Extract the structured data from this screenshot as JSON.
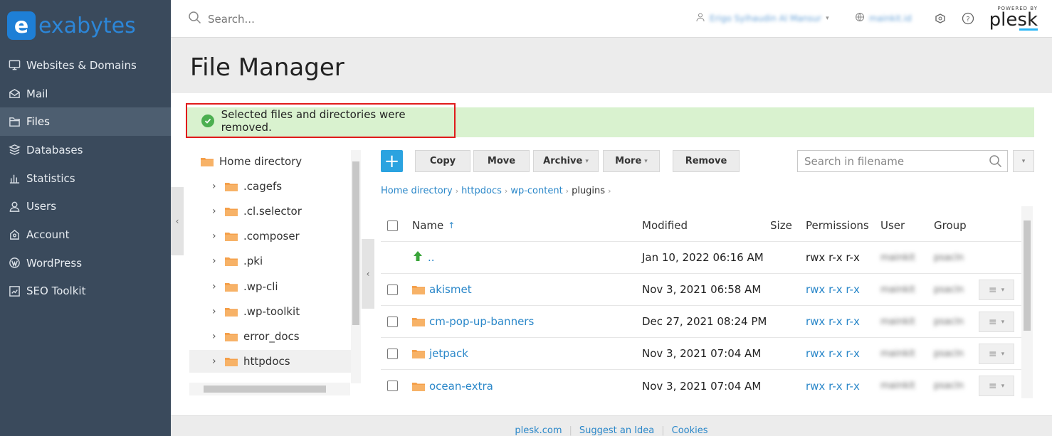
{
  "brand": {
    "logo_letter": "e",
    "logo_text": "exabytes"
  },
  "sidebar": {
    "items": [
      {
        "label": "Websites & Domains",
        "icon": "monitor-icon"
      },
      {
        "label": "Mail",
        "icon": "mail-icon"
      },
      {
        "label": "Files",
        "icon": "files-icon",
        "active": true
      },
      {
        "label": "Databases",
        "icon": "database-icon"
      },
      {
        "label": "Statistics",
        "icon": "statistics-icon"
      },
      {
        "label": "Users",
        "icon": "user-icon"
      },
      {
        "label": "Account",
        "icon": "account-icon"
      },
      {
        "label": "WordPress",
        "icon": "wordpress-icon"
      },
      {
        "label": "SEO Toolkit",
        "icon": "seo-icon"
      }
    ]
  },
  "topbar": {
    "search_placeholder": "Search...",
    "user_name": "Erigo Syihaudin Al Mansur",
    "subscription": "mainkit.id",
    "powered_by": "POWERED BY",
    "plesk": "plesk"
  },
  "page": {
    "title": "File Manager",
    "alert": "Selected files and directories were removed."
  },
  "tree": {
    "root": "Home directory",
    "items": [
      ".cagefs",
      ".cl.selector",
      ".composer",
      ".pki",
      ".wp-cli",
      ".wp-toolkit",
      "error_docs",
      "httpdocs"
    ]
  },
  "toolbar": {
    "add": "+",
    "copy": "Copy",
    "move": "Move",
    "archive": "Archive",
    "more": "More",
    "remove": "Remove",
    "search_placeholder": "Search in filename"
  },
  "breadcrumb": [
    "Home directory",
    "httpdocs",
    "wp-content",
    "plugins"
  ],
  "table": {
    "headers": {
      "name": "Name",
      "modified": "Modified",
      "size": "Size",
      "permissions": "Permissions",
      "user": "User",
      "group": "Group"
    },
    "sort_indicator": "↑",
    "rows": [
      {
        "name": "..",
        "modified": "Jan 10, 2022 06:16 AM",
        "permissions": "rwx r-x r-x",
        "user": "mainkit",
        "group": "psacln",
        "parent": true
      },
      {
        "name": "akismet",
        "modified": "Nov 3, 2021 06:58 AM",
        "permissions": "rwx r-x r-x",
        "user": "mainkit",
        "group": "psacln"
      },
      {
        "name": "cm-pop-up-banners",
        "modified": "Dec 27, 2021 08:24 PM",
        "permissions": "rwx r-x r-x",
        "user": "mainkit",
        "group": "psacln"
      },
      {
        "name": "jetpack",
        "modified": "Nov 3, 2021 07:04 AM",
        "permissions": "rwx r-x r-x",
        "user": "mainkit",
        "group": "psacln"
      },
      {
        "name": "ocean-extra",
        "modified": "Nov 3, 2021 07:04 AM",
        "permissions": "rwx r-x r-x",
        "user": "mainkit",
        "group": "psacln"
      }
    ]
  },
  "footer": {
    "links": [
      "plesk.com",
      "Suggest an Idea",
      "Cookies"
    ]
  },
  "colors": {
    "sidebar": "#3a4a5c",
    "accent": "#2ba3e0",
    "link": "#2a87c9",
    "alert_bg": "#d9f2cf",
    "highlight": "#e01b1b",
    "folder": "#f5a04a"
  }
}
